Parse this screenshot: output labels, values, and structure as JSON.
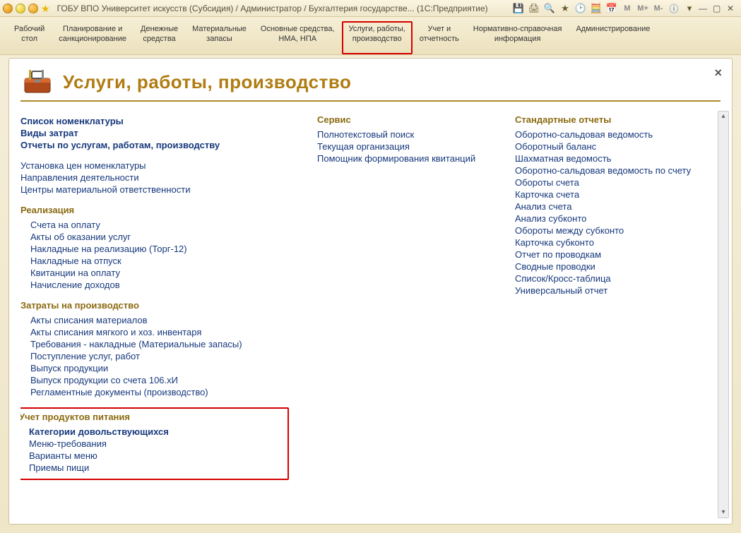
{
  "window": {
    "title": "ГОБУ ВПО Университет искусств (Субсидия) / Администратор / Бухгалтерия государстве...  (1С:Предприятие)",
    "m_buttons": [
      "M",
      "M+",
      "M-"
    ]
  },
  "sections": [
    {
      "l1": "Рабочий",
      "l2": "стол"
    },
    {
      "l1": "Планирование и",
      "l2": "санкционирование"
    },
    {
      "l1": "Денежные",
      "l2": "средства"
    },
    {
      "l1": "Материальные",
      "l2": "запасы"
    },
    {
      "l1": "Основные средства,",
      "l2": "НМА, НПА"
    },
    {
      "l1": "Услуги, работы,",
      "l2": "производство",
      "active": true
    },
    {
      "l1": "Учет и",
      "l2": "отчетность"
    },
    {
      "l1": "Нормативно-справочная",
      "l2": "информация"
    },
    {
      "l1": "Администрирование",
      "l2": ""
    }
  ],
  "page": {
    "title": "Услуги, работы, производство"
  },
  "col1": {
    "top": [
      "Список номенклатуры",
      "Виды затрат",
      "Отчеты по услугам, работам, производству"
    ],
    "plain": [
      "Установка цен номенклатуры",
      "Направления деятельности",
      "Центры материальной ответственности"
    ],
    "g_realization": {
      "title": "Реализация",
      "items": [
        "Счета на оплату",
        "Акты об оказании услуг",
        "Накладные на реализацию (Торг-12)",
        "Накладные на отпуск",
        "Квитанции на оплату",
        "Начисление доходов"
      ]
    },
    "g_costs": {
      "title": "Затраты на производство",
      "items": [
        "Акты списания материалов",
        "Акты списания мягкого и хоз. инвентаря",
        "Требования - накладные (Материальные запасы)",
        "Поступление услуг, работ",
        "Выпуск продукции",
        "Выпуск продукции со счета 106.хИ",
        "Регламентные документы (производство)"
      ]
    },
    "g_food": {
      "title": "Учет продуктов питания",
      "bold_item": "Категории довольствующихся",
      "items": [
        "Меню-требования",
        "Варианты меню",
        "Приемы пищи"
      ]
    }
  },
  "col2": {
    "title": "Сервис",
    "items": [
      "Полнотекстовый поиск",
      "Текущая организация",
      "Помощник формирования квитанций"
    ]
  },
  "col3": {
    "title": "Стандартные отчеты",
    "items": [
      "Оборотно-сальдовая ведомость",
      "Оборотный баланс",
      "Шахматная ведомость",
      "Оборотно-сальдовая ведомость по счету",
      "Обороты счета",
      "Карточка счета",
      "Анализ счета",
      "Анализ субконто",
      "Обороты между субконто",
      "Карточка субконто",
      "Отчет по проводкам",
      "Сводные проводки",
      "Список/Кросс-таблица",
      "Универсальный отчет"
    ]
  }
}
